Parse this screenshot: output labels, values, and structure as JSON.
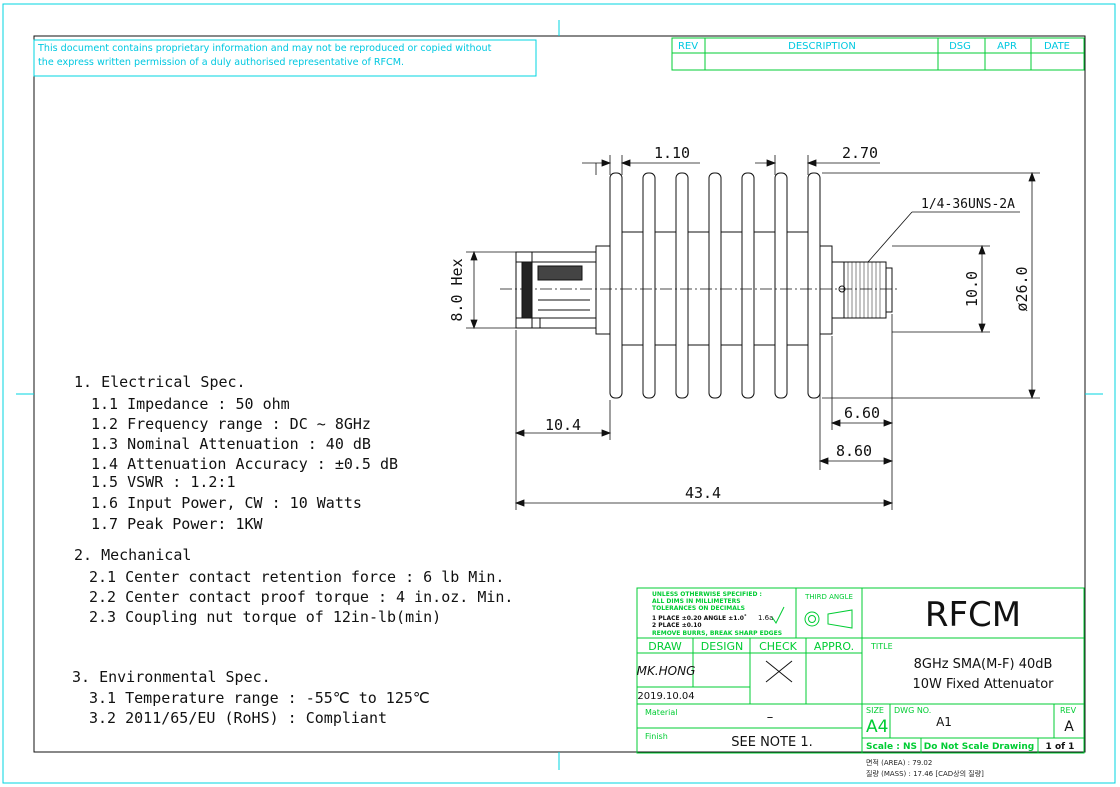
{
  "notice": {
    "line1": "This document contains proprietary information and may not be reproduced or copied without",
    "line2": "the express written permission of a duly authorised representative of RFCM."
  },
  "revision_table": {
    "headers": [
      "REV",
      "DESCRIPTION",
      "DSG",
      "APR",
      "DATE"
    ]
  },
  "dimensions": {
    "d_1_10": "1.10",
    "d_2_70": "2.70",
    "thread": "1/4-36UNS-2A",
    "hex": "8.0 Hex",
    "d_10_0": "10.0",
    "dia_26": "ø26.0",
    "d_6_60": "6.60",
    "d_10_4": "10.4",
    "d_8_60": "8.60",
    "d_43_4": "43.4"
  },
  "specs": {
    "electrical": {
      "heading": "1. Electrical Spec.",
      "items": [
        "1.1 Impedance : 50 ohm",
        "1.2 Frequency range : DC ~ 8GHz",
        "1.3 Nominal Attenuation : 40 dB",
        "1.4 Attenuation Accuracy : ±0.5 dB",
        "1.5 VSWR : 1.2:1",
        "1.6 Input Power, CW : 10 Watts",
        "1.7 Peak Power: 1KW"
      ]
    },
    "mechanical": {
      "heading": "2. Mechanical",
      "items": [
        "2.1 Center contact retention force : 6 lb Min.",
        "2.2 Center contact proof torque : 4 in.oz. Min.",
        "2.3 Coupling nut torque of 12in-lb(min)"
      ]
    },
    "environmental": {
      "heading": "3. Environmental Spec.",
      "items": [
        "3.1 Temperature range : -55℃ to 125℃",
        "3.2 2011/65/EU (RoHS) : Compliant"
      ]
    }
  },
  "title_block": {
    "tolerances": [
      "UNLESS OTHERWISE SPECIFIED :",
      "ALL DIMS IN MILLIMETERS",
      "TOLERANCES ON DECIMALS",
      "1 PLACE ±0.20   ANGLE ±1.0˚",
      "2 PLACE ±0.10",
      "REMOVE BURRS, BREAK SHARP EDGES"
    ],
    "finish_symbol": "1.6a",
    "third_angle": "THIRD ANGLE",
    "draw": "DRAW",
    "design": "DESIGN",
    "check": "CHECK",
    "appro": "APPRO.",
    "signature": "MK.HONG",
    "date": "2019.10.04",
    "material_label": "Material",
    "material_value": "–",
    "finish_label": "Finish",
    "finish_value": "SEE NOTE 1.",
    "company": "RFCM",
    "title_label": "TITLE",
    "title_line1": "8GHz SMA(M-F) 40dB",
    "title_line2": "10W Fixed Attenuator",
    "size_label": "SIZE",
    "size_value": "A4",
    "dwg_label": "DWG NO.",
    "dwg_value": "A1",
    "rev_label": "REV",
    "rev_value": "A",
    "scale": "Scale : NS",
    "do_not_scale": "Do Not Scale Drawing",
    "sheet": "1 of 1"
  },
  "footer": {
    "area": "면적 (AREA) : 79.02",
    "mass": "질량 (MASS) : 17.46 [CAD상의 질량]"
  }
}
